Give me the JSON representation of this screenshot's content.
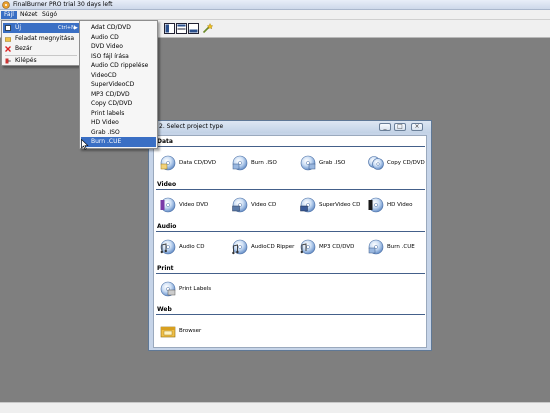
{
  "window": {
    "title": "FinalBurner PRO trial 30 days left"
  },
  "menubar": {
    "file": "Fájl",
    "view": "Nézet",
    "help": "Súgó"
  },
  "file_menu": {
    "new": "Új",
    "new_shortcut": "Ctrl+N",
    "open_task": "Feladat megnyitása",
    "close": "Bezár",
    "exit": "Kilépés"
  },
  "new_submenu": [
    "Adat CD/DVD",
    "Audio CD",
    "DVD Video",
    "ISO fájl írása",
    "Audio CD rippelése",
    "VideoCD",
    "SuperVideoCD",
    "MP3 CD/DVD",
    "Copy CD/DVD",
    "Print labels",
    "HD Video",
    "Grab .ISO",
    "Burn .CUE"
  ],
  "dialog": {
    "title": "2. Select project type",
    "categories": [
      {
        "name": "Data",
        "items": [
          "Data CD/DVD",
          "Burn .ISO",
          "Grab .ISO",
          "Copy CD/DVD"
        ]
      },
      {
        "name": "Video",
        "items": [
          "Video DVD",
          "Video CD",
          "SuperVideo CD",
          "HD Video"
        ]
      },
      {
        "name": "Audio",
        "items": [
          "Audio CD",
          "AudioCD Ripper",
          "MP3 CD/DVD",
          "Burn .CUE"
        ]
      },
      {
        "name": "Print",
        "items": [
          "Print Labels"
        ]
      },
      {
        "name": "Web",
        "items": [
          "Browser"
        ]
      }
    ]
  },
  "colors": {
    "highlight": "#3a6fc4",
    "workspace": "#7f7f7f",
    "dialog_frame": "#c6d4e8",
    "category_line": "#44608a"
  }
}
